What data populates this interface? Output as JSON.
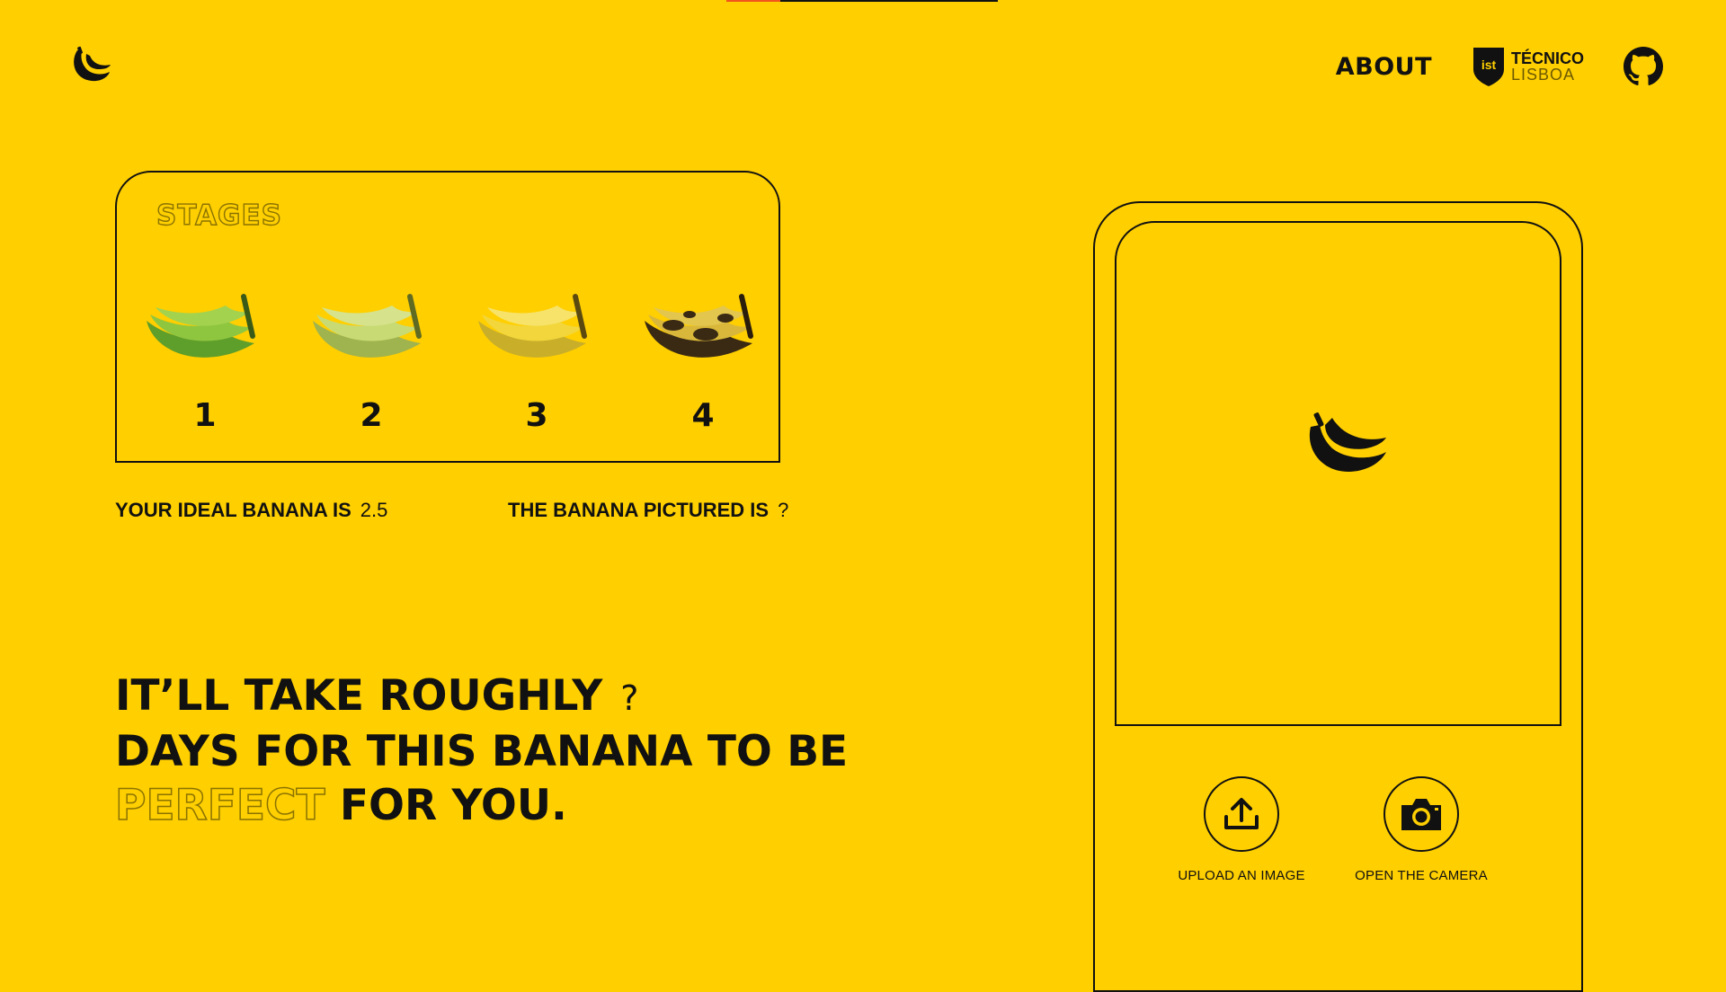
{
  "header": {
    "logo_icon": "banana-logo-icon",
    "about_label": "ABOUT",
    "institution": {
      "line1": "TÉCNICO",
      "line2": "LISBOA",
      "shield_text": "ist"
    },
    "github_icon": "github-icon"
  },
  "stages": {
    "title": "STAGES",
    "items": [
      {
        "label": "1",
        "color": "#8FC63F",
        "shade": "#5E9E2A"
      },
      {
        "label": "2",
        "color": "#C8DA73",
        "shade": "#9FB34E"
      },
      {
        "label": "3",
        "color": "#F2D63B",
        "shade": "#C9AE2A"
      },
      {
        "label": "4",
        "color": "#D9B73A",
        "shade": "#3A2A14"
      }
    ]
  },
  "info": {
    "ideal_label": "YOUR IDEAL BANANA IS",
    "ideal_value": "2.5",
    "pictured_label": "THE BANANA PICTURED IS",
    "pictured_value": "?"
  },
  "headline": {
    "line1": "IT’LL TAKE ROUGHLY",
    "days_value": "?",
    "line2": "DAYS FOR THIS BANANA TO BE",
    "outline_word": "PERFECT",
    "line3_rest": "FOR YOU."
  },
  "phone": {
    "preview_icon": "banana-icon",
    "upload_label": "UPLOAD AN IMAGE",
    "camera_label": "OPEN THE CAMERA"
  },
  "colors": {
    "background": "#FFCF00",
    "ink": "#111111",
    "accent": "#F2551E"
  }
}
